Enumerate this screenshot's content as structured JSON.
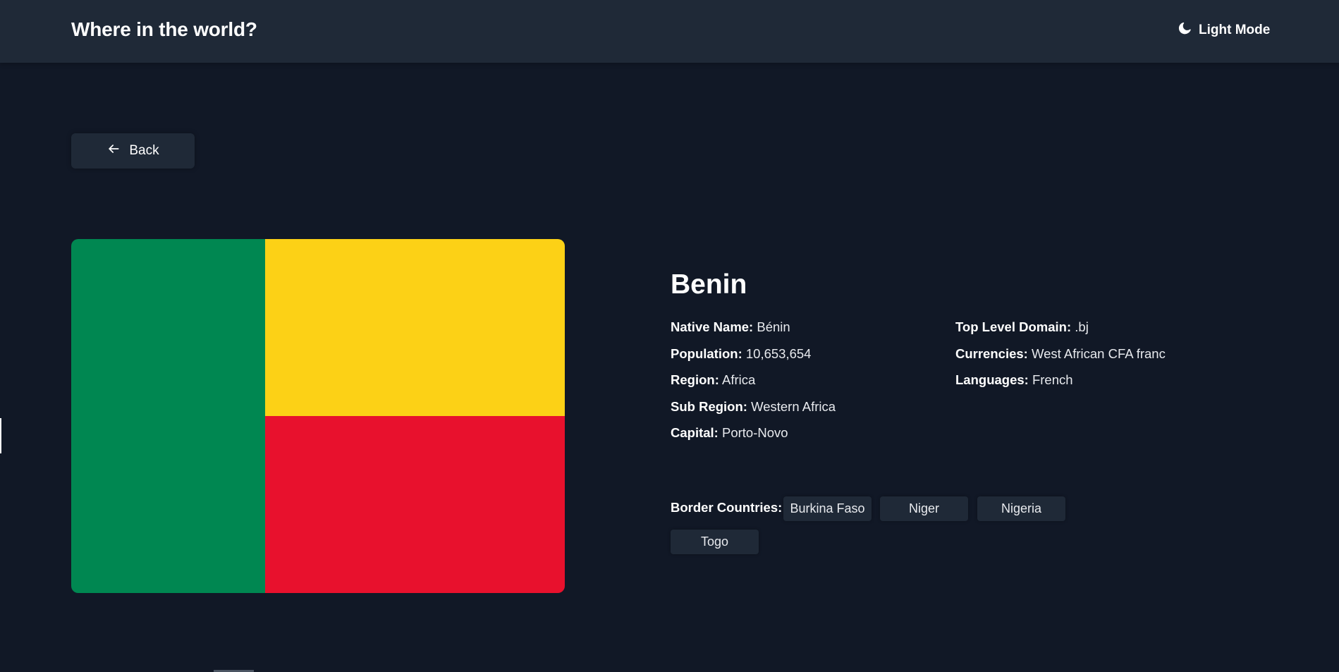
{
  "header": {
    "title": "Where in the world?",
    "mode_toggle_label": "Light Mode",
    "mode_icon": "moon-icon"
  },
  "back_button": {
    "label": "Back",
    "icon": "arrow-left-icon"
  },
  "flag": {
    "colors": {
      "green": "#008751",
      "yellow": "#FCD116",
      "red": "#E8112D"
    }
  },
  "country": {
    "name": "Benin",
    "details_left": [
      {
        "label": "Native Name:",
        "value": "Bénin"
      },
      {
        "label": "Population:",
        "value": "10,653,654"
      },
      {
        "label": "Region:",
        "value": "Africa"
      },
      {
        "label": "Sub Region:",
        "value": "Western Africa"
      },
      {
        "label": "Capital:",
        "value": "Porto-Novo"
      }
    ],
    "details_right": [
      {
        "label": "Top Level Domain:",
        "value": ".bj"
      },
      {
        "label": "Currencies:",
        "value": "West African CFA franc"
      },
      {
        "label": "Languages:",
        "value": "French"
      }
    ],
    "border_countries_label": "Border Countries:",
    "border_countries": [
      "Burkina Faso",
      "Niger",
      "Nigeria",
      "Togo"
    ]
  },
  "theme": {
    "background": "#111826",
    "element": "#1f2937",
    "text": "#ffffff"
  }
}
